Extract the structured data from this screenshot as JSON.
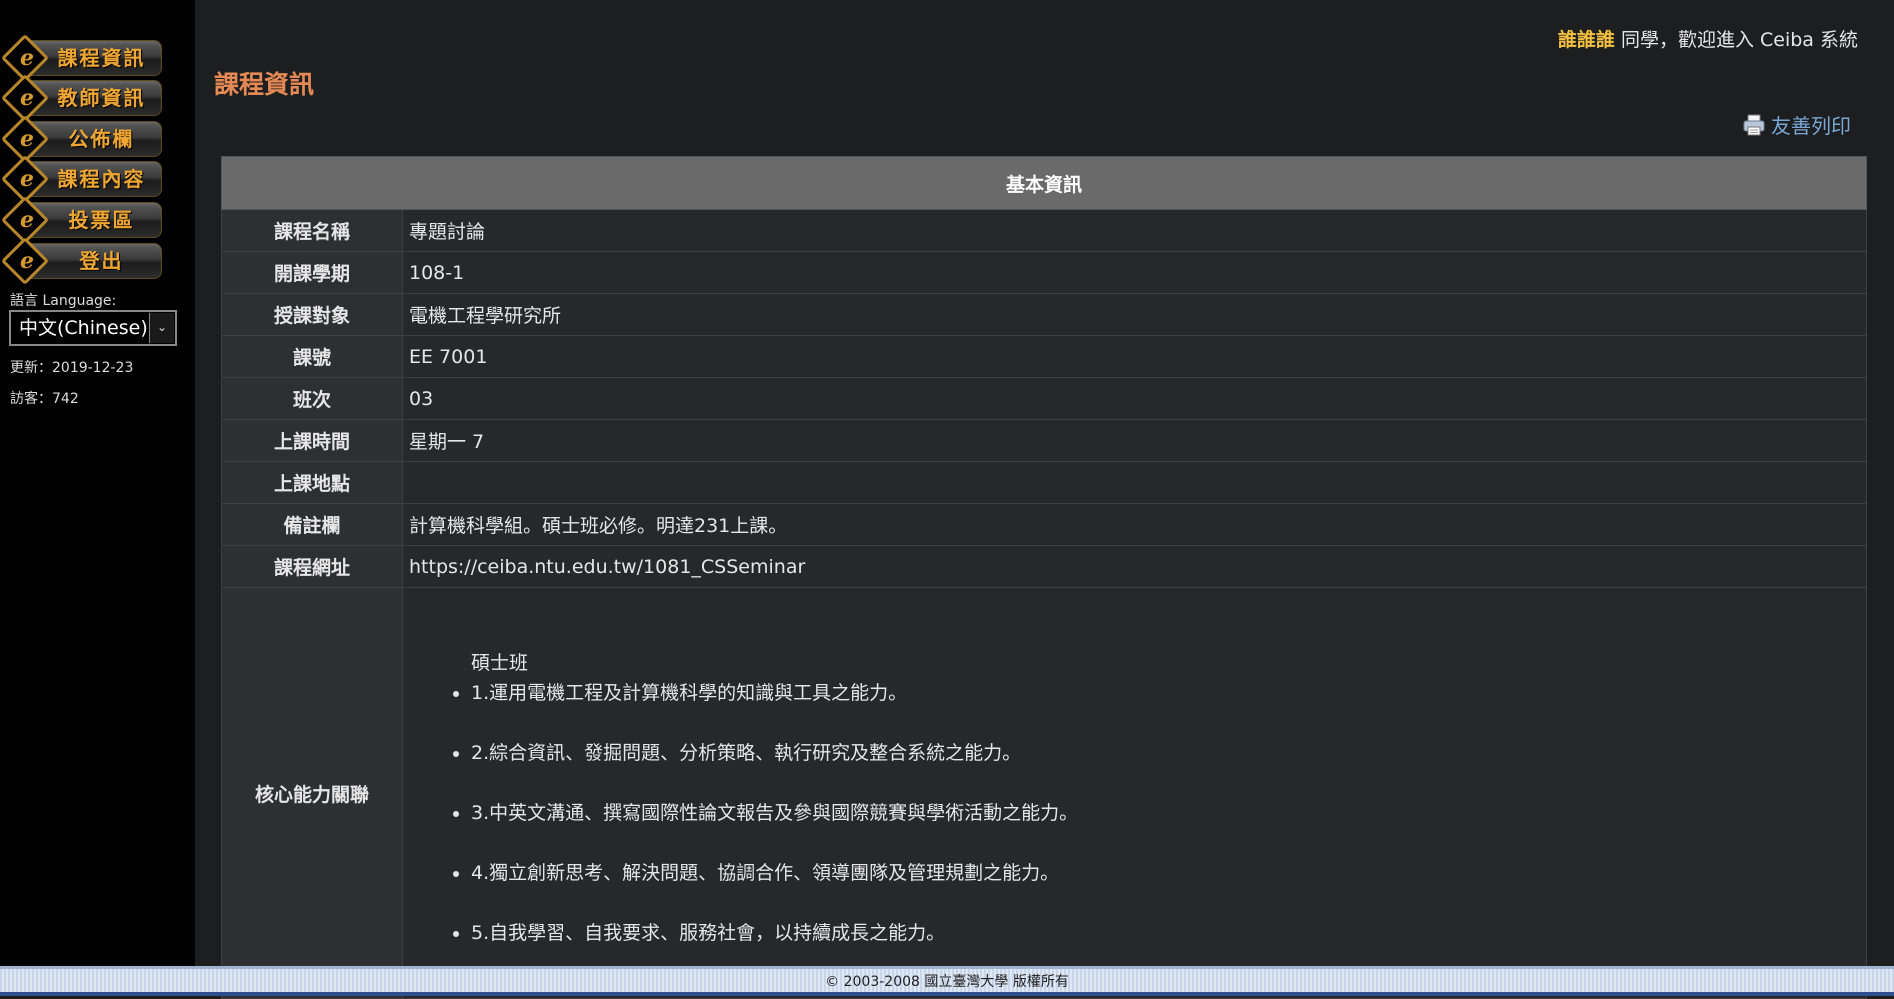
{
  "sidebar": {
    "nav": [
      {
        "label": "課程資訊"
      },
      {
        "label": "教師資訊"
      },
      {
        "label": "公佈欄"
      },
      {
        "label": "課程內容"
      },
      {
        "label": "投票區"
      },
      {
        "label": "登出"
      }
    ],
    "language_label": "語言 Language:",
    "language_value": "中文(Chinese)",
    "updated": "更新：2019-12-23",
    "visitors": "訪客：742"
  },
  "header": {
    "user_name": "誰誰誰",
    "welcome_suffix": " 同學，歡迎進入 Ceiba 系統",
    "page_title": "課程資訊",
    "print_label": "友善列印"
  },
  "table": {
    "heading": "基本資訊",
    "rows": [
      {
        "label": "課程名稱",
        "value": "專題討論"
      },
      {
        "label": "開課學期",
        "value": "108-1"
      },
      {
        "label": "授課對象",
        "value": "電機工程學研究所"
      },
      {
        "label": "課號",
        "value": "EE 7001"
      },
      {
        "label": "班次",
        "value": "03"
      },
      {
        "label": "上課時間",
        "value": "星期一 7"
      },
      {
        "label": "上課地點",
        "value": ""
      },
      {
        "label": "備註欄",
        "value": "計算機科學組。碩士班必修。明達231上課。"
      },
      {
        "label": "課程網址",
        "value": "https://ceiba.ntu.edu.tw/1081_CSSeminar"
      }
    ],
    "core": {
      "label": "核心能力關聯",
      "heading": "碩士班",
      "items": [
        "1.運用電機工程及計算機科學的知識與工具之能力。",
        "2.綜合資訊、發掘問題、分析策略、執行研究及整合系統之能力。",
        "3.中英文溝通、撰寫國際性論文報告及參與國際競賽與學術活動之能力。",
        "4.獨立創新思考、解決問題、協調合作、領導團隊及管理規劃之能力。",
        "5.自我學習、自我要求、服務社會，以持續成長之能力。"
      ]
    }
  },
  "footer": {
    "text": "© 2003-2008 國立臺灣大學 版權所有"
  },
  "colors": {
    "accent_orange": "#e58a54",
    "nav_gold": "#f0a732",
    "username_yellow": "#f3c041",
    "link_blue": "#79a8d4"
  }
}
